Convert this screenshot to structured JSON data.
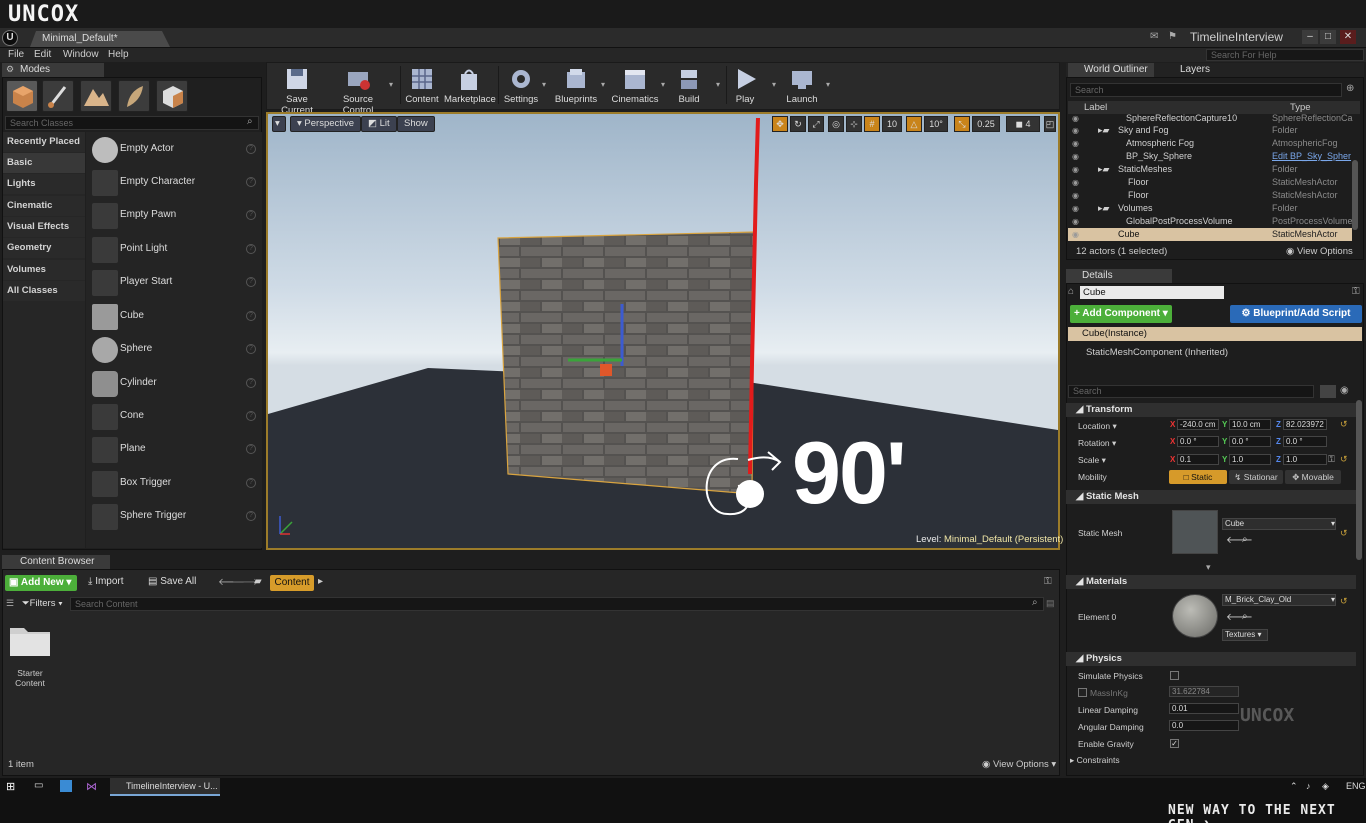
{
  "brand": "UNCOX",
  "slogan": "NEW WAY TO THE NEXT GEN ❯",
  "watermark": "UNCOX",
  "window": {
    "doc_tab": "Minimal_Default*",
    "project": "TimelineInterview",
    "search_help": "Search For Help"
  },
  "menu": [
    "File",
    "Edit",
    "Window",
    "Help"
  ],
  "modes": {
    "tab": "Modes",
    "search_placeholder": "Search Classes",
    "categories": [
      "Recently Placed",
      "Basic",
      "Lights",
      "Cinematic",
      "Visual Effects",
      "Geometry",
      "Volumes",
      "All Classes"
    ],
    "items": [
      "Empty Actor",
      "Empty Character",
      "Empty Pawn",
      "Point Light",
      "Player Start",
      "Cube",
      "Sphere",
      "Cylinder",
      "Cone",
      "Plane",
      "Box Trigger",
      "Sphere Trigger"
    ]
  },
  "toolbar": {
    "buttons": [
      "Save Current",
      "Source Control",
      "Content",
      "Marketplace",
      "Settings",
      "Blueprints",
      "Cinematics",
      "Build",
      "Play",
      "Launch"
    ]
  },
  "viewport": {
    "perspective": "Perspective",
    "lit": "Lit",
    "show": "Show",
    "snap_grid": "10",
    "snap_rot": "10°",
    "snap_scale": "0.25",
    "cam_speed": "4",
    "level_label": "Level:",
    "level_name": "Minimal_Default (Persistent)",
    "annotation": "90'"
  },
  "outliner": {
    "tab": "World Outliner",
    "layers_tab": "Layers",
    "search_placeholder": "Search",
    "col_label": "Label",
    "col_type": "Type",
    "rows": [
      {
        "name": "SphereReflectionCapture10",
        "type": "SphereReflectionCa"
      },
      {
        "name": "Sky and Fog",
        "type": "Folder"
      },
      {
        "name": "Atmospheric Fog",
        "type": "AtmosphericFog"
      },
      {
        "name": "BP_Sky_Sphere",
        "type": "Edit BP_Sky_Spher"
      },
      {
        "name": "StaticMeshes",
        "type": "Folder"
      },
      {
        "name": "Floor",
        "type": "StaticMeshActor"
      },
      {
        "name": "Floor",
        "type": "StaticMeshActor"
      },
      {
        "name": "Volumes",
        "type": "Folder"
      },
      {
        "name": "GlobalPostProcessVolume",
        "type": "PostProcessVolume"
      },
      {
        "name": "Cube",
        "type": "StaticMeshActor"
      }
    ],
    "count": "12 actors (1 selected)",
    "view_options": "View Options"
  },
  "details": {
    "tab": "Details",
    "actor_name": "Cube",
    "add_component": "+ Add Component",
    "blueprint": "Blueprint/Add Script",
    "instance": "Cube(Instance)",
    "component": "StaticMeshComponent (Inherited)",
    "search_placeholder": "Search",
    "transform": "Transform",
    "location_label": "Location",
    "rotation_label": "Rotation",
    "scale_label": "Scale",
    "mobility_label": "Mobility",
    "location": [
      "-240.0 cm",
      "10.0 cm",
      "82.023972"
    ],
    "rotation": [
      "0.0 °",
      "0.0 °",
      "0.0 °"
    ],
    "scale": [
      "0.1",
      "1.0",
      "1.0"
    ],
    "mobility": [
      "Static",
      "Stationar",
      "Movable"
    ],
    "static_mesh_section": "Static Mesh",
    "static_mesh_label": "Static Mesh",
    "static_mesh_value": "Cube",
    "materials_section": "Materials",
    "element_label": "Element 0",
    "material_value": "M_Brick_Clay_Old",
    "textures_btn": "Textures",
    "physics_section": "Physics",
    "simulate_physics": "Simulate Physics",
    "mass_label": "MassInKg",
    "mass_value": "31.622784",
    "linear_damping": "Linear Damping",
    "linear_value": "0.01",
    "angular_damping": "Angular Damping",
    "angular_value": "0.0",
    "enable_gravity": "Enable Gravity",
    "constraints": "Constraints"
  },
  "content_browser": {
    "tab": "Content Browser",
    "add_new": "Add New",
    "import": "Import",
    "save_all": "Save All",
    "crumb": "Content",
    "filters": "Filters",
    "search_placeholder": "Search Content",
    "folder_label": "Starter Content",
    "item_count": "1 item",
    "view_options": "View Options"
  },
  "taskbar": {
    "app": "TimelineInterview - U...",
    "lang": "ENG"
  }
}
